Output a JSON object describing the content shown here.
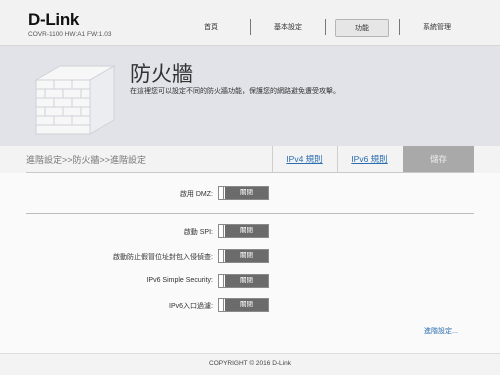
{
  "header": {
    "brand": "D-Link",
    "model": "COVR-1100 HW:A1 FW:1.03",
    "nav": [
      {
        "label": "首頁"
      },
      {
        "label": "基本設定"
      },
      {
        "label": "功能",
        "active": true
      },
      {
        "label": "系統管理"
      }
    ]
  },
  "banner": {
    "title": "防火牆",
    "description": "在這裡您可以設定不同的防火牆功能，保護您的網路避免遭受攻擊。"
  },
  "toolbar": {
    "breadcrumb": "進階設定>>防火牆>>進階設定",
    "ipv4_rules": "IPv4 規則",
    "ipv6_rules": "IPv6 規則",
    "save": "儲存"
  },
  "settings": [
    {
      "label": "啟用 DMZ:",
      "state": "關閉"
    },
    {
      "label": "啟動 SPI:",
      "state": "關閉"
    },
    {
      "label": "啟動防止假冒位址封包入侵偵查:",
      "state": "關閉"
    },
    {
      "label": "IPv6 Simple Security:",
      "state": "關閉"
    },
    {
      "label": "IPv6入口過濾:",
      "state": "關閉"
    }
  ],
  "advanced_link": "進階設定...",
  "footer": {
    "copyright": "COPYRIGHT © 2016 D-Link"
  },
  "colors": {
    "banner_bg": "#e1e3e8",
    "toggle_off": "#6b6b6b",
    "link": "#2a6db0",
    "save_disabled": "#a9a9a9"
  }
}
